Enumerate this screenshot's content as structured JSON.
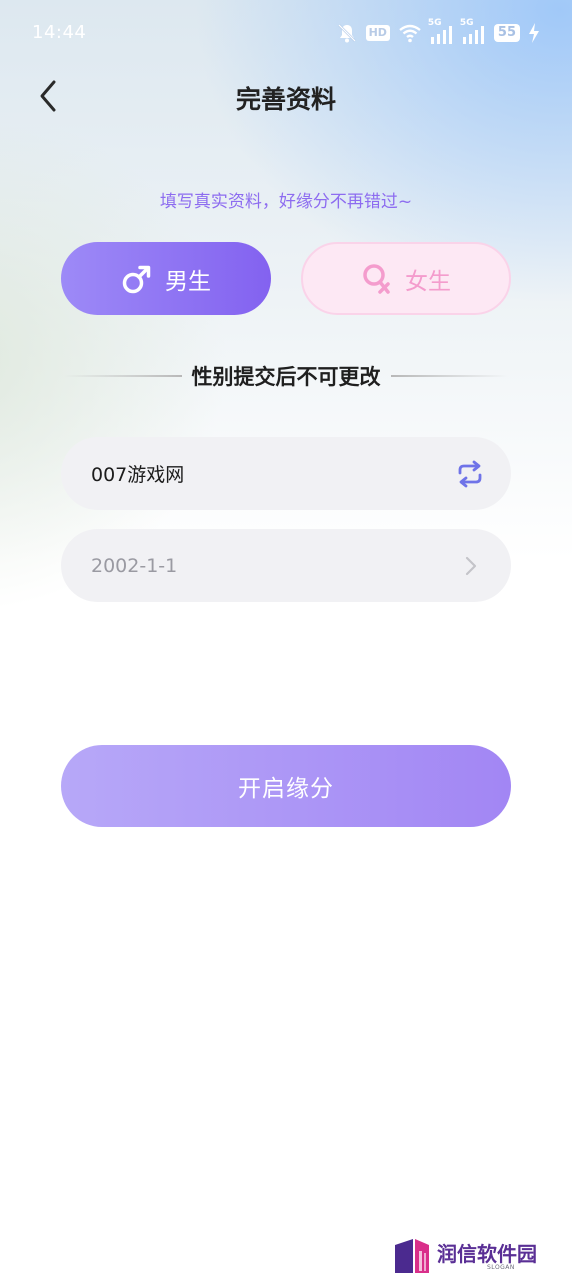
{
  "status_bar": {
    "time": "14:44",
    "hd_label": "HD",
    "network_label_1": "5G",
    "network_label_2": "5G",
    "battery": "55"
  },
  "header": {
    "title": "完善资料"
  },
  "subtitle": "填写真实资料，好缘分不再错过~",
  "gender": {
    "selected": "male",
    "male_label": "男生",
    "female_label": "女生"
  },
  "notice": "性别提交后不可更改",
  "form": {
    "nickname_value": "007游戏网",
    "birthday_value": "2002-1-1"
  },
  "start_button_label": "开启缘分",
  "watermark": {
    "text": "润信软件园",
    "slogan": "SLOGAN"
  },
  "colors": {
    "accent_purple": "#8362f0",
    "female_pink": "#f49ccd",
    "field_bg": "#f1f1f4",
    "refresh_icon": "#6f73e8"
  }
}
